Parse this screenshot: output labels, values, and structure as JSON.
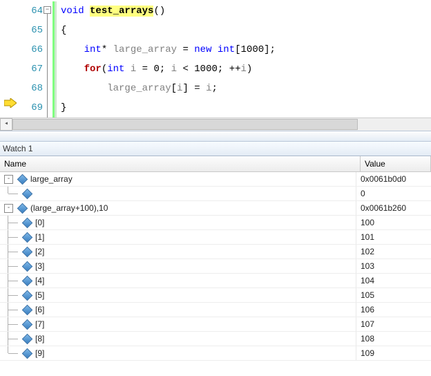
{
  "editor": {
    "lines": [
      {
        "num": "64",
        "fold": true,
        "tokens": [
          {
            "t": "void ",
            "c": "kw"
          },
          {
            "t": "test_arrays",
            "c": "fn-name"
          },
          {
            "t": "()",
            "c": "punct"
          }
        ]
      },
      {
        "num": "65",
        "tokens": [
          {
            "t": "{",
            "c": "punct"
          }
        ]
      },
      {
        "num": "66",
        "tokens": [
          {
            "t": "    ",
            "c": ""
          },
          {
            "t": "int",
            "c": "kw"
          },
          {
            "t": "* ",
            "c": "punct"
          },
          {
            "t": "large_array",
            "c": "id-gray"
          },
          {
            "t": " = ",
            "c": "punct"
          },
          {
            "t": "new ",
            "c": "kw"
          },
          {
            "t": "int",
            "c": "kw"
          },
          {
            "t": "[1000];",
            "c": "punct"
          }
        ]
      },
      {
        "num": "67",
        "tokens": [
          {
            "t": "    ",
            "c": ""
          },
          {
            "t": "for",
            "c": "kw-red"
          },
          {
            "t": "(",
            "c": "punct"
          },
          {
            "t": "int ",
            "c": "kw"
          },
          {
            "t": "i",
            "c": "id-gray"
          },
          {
            "t": " = 0; ",
            "c": "punct"
          },
          {
            "t": "i",
            "c": "id-gray"
          },
          {
            "t": " < 1000; ++",
            "c": "punct"
          },
          {
            "t": "i",
            "c": "id-gray"
          },
          {
            "t": ")",
            "c": "punct"
          }
        ]
      },
      {
        "num": "68",
        "tokens": [
          {
            "t": "        ",
            "c": ""
          },
          {
            "t": "large_array",
            "c": "id-gray"
          },
          {
            "t": "[",
            "c": "punct"
          },
          {
            "t": "i",
            "c": "id-gray"
          },
          {
            "t": "] = ",
            "c": "punct"
          },
          {
            "t": "i",
            "c": "id-gray"
          },
          {
            "t": ";",
            "c": "punct"
          }
        ]
      },
      {
        "num": "69",
        "arrow": true,
        "tokens": [
          {
            "t": "}",
            "c": "punct"
          }
        ]
      }
    ]
  },
  "watch": {
    "title": "Watch 1",
    "headers": {
      "name": "Name",
      "value": "Value"
    },
    "rows": [
      {
        "depth": 0,
        "toggle": "-",
        "icon": true,
        "name": "large_array",
        "value": "0x0061b0d0"
      },
      {
        "depth": 1,
        "last": true,
        "icon": true,
        "name": "",
        "value": "0"
      },
      {
        "depth": 0,
        "toggle": "-",
        "icon": true,
        "name": "(large_array+100),10",
        "value": "0x0061b260"
      },
      {
        "depth": 1,
        "icon": true,
        "name": "[0]",
        "value": "100"
      },
      {
        "depth": 1,
        "icon": true,
        "name": "[1]",
        "value": "101"
      },
      {
        "depth": 1,
        "icon": true,
        "name": "[2]",
        "value": "102"
      },
      {
        "depth": 1,
        "icon": true,
        "name": "[3]",
        "value": "103"
      },
      {
        "depth": 1,
        "icon": true,
        "name": "[4]",
        "value": "104"
      },
      {
        "depth": 1,
        "icon": true,
        "name": "[5]",
        "value": "105"
      },
      {
        "depth": 1,
        "icon": true,
        "name": "[6]",
        "value": "106"
      },
      {
        "depth": 1,
        "icon": true,
        "name": "[7]",
        "value": "107"
      },
      {
        "depth": 1,
        "icon": true,
        "name": "[8]",
        "value": "108"
      },
      {
        "depth": 1,
        "last": true,
        "icon": true,
        "name": "[9]",
        "value": "109"
      }
    ]
  }
}
